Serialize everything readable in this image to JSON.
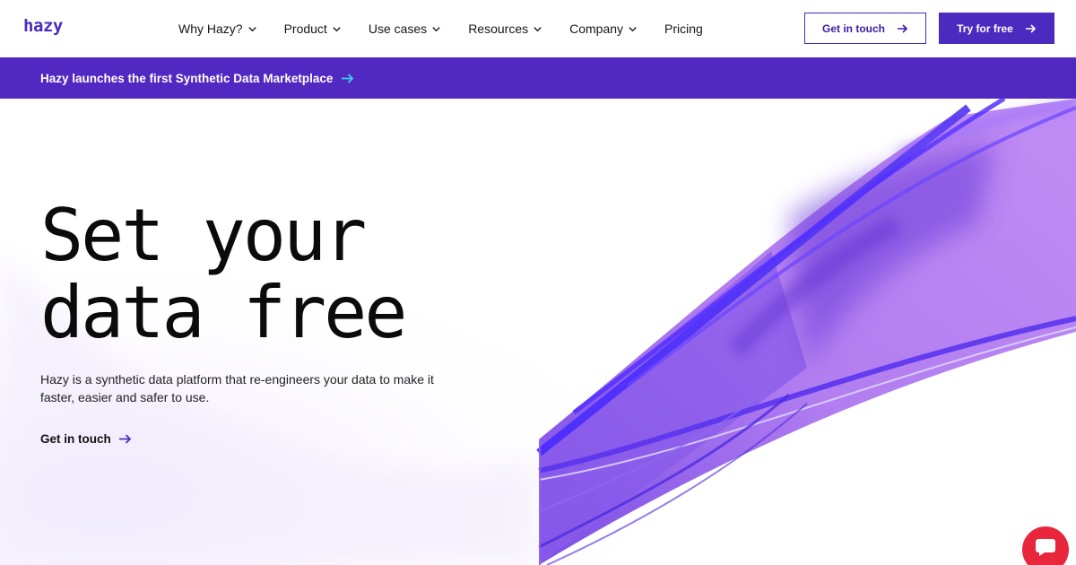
{
  "brand": {
    "logo_text": "hazy",
    "accent": "#4b2bbf",
    "banner_color": "#5128c2",
    "chat_color": "#e8263c"
  },
  "nav": {
    "items": [
      {
        "label": "Why Hazy?",
        "icon": "chevron-down-icon"
      },
      {
        "label": "Product",
        "icon": "chevron-down-icon"
      },
      {
        "label": "Use cases",
        "icon": "chevron-down-icon"
      },
      {
        "label": "Resources",
        "icon": "chevron-down-icon"
      },
      {
        "label": "Company",
        "icon": "chevron-down-icon"
      },
      {
        "label": "Pricing"
      }
    ],
    "get_in_touch_label": "Get in touch",
    "try_free_label": "Try for free"
  },
  "banner": {
    "text": "Hazy launches the first Synthetic Data Marketplace",
    "icon": "arrow-right-icon"
  },
  "hero": {
    "headline_line1": "Set your",
    "headline_line2": "data free",
    "subtitle": "Hazy is a synthetic data platform that re-engineers your data to make it faster, easier and safer to use.",
    "cta_label": "Get in touch"
  },
  "chat": {
    "icon": "chat-bubble-icon"
  }
}
